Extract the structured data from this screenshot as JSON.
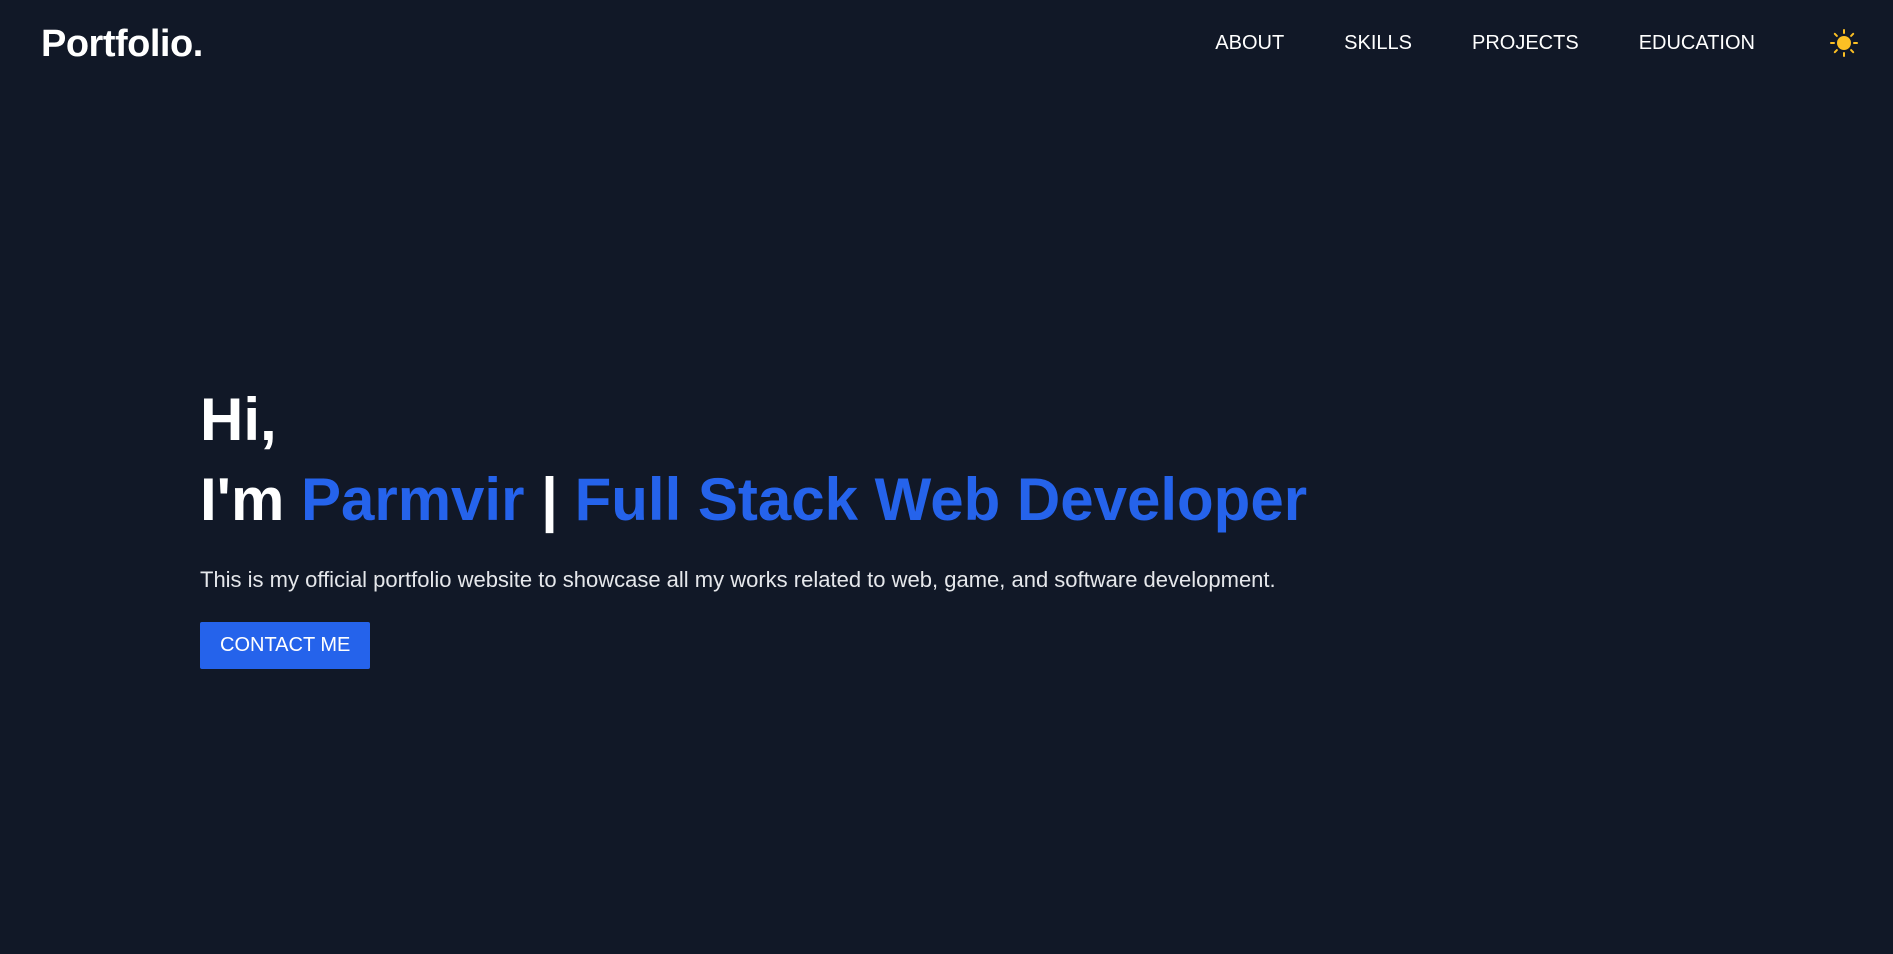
{
  "header": {
    "logo": "Portfolio.",
    "nav": [
      {
        "label": "ABOUT"
      },
      {
        "label": "SKILLS"
      },
      {
        "label": "PROJECTS"
      },
      {
        "label": "EDUCATION"
      }
    ],
    "theme_toggle_icon": "sun-icon"
  },
  "hero": {
    "greeting": "Hi,",
    "prefix": "I'm",
    "name": "Parmvir",
    "separator": "|",
    "role": "Full Stack Web Developer",
    "intro": "This is my official portfolio website to showcase all my works related to web, game, and software development.",
    "cta_label": "CONTACT ME"
  },
  "colors": {
    "background": "#111827",
    "accent": "#2563eb",
    "sun": "#fbbf24"
  }
}
